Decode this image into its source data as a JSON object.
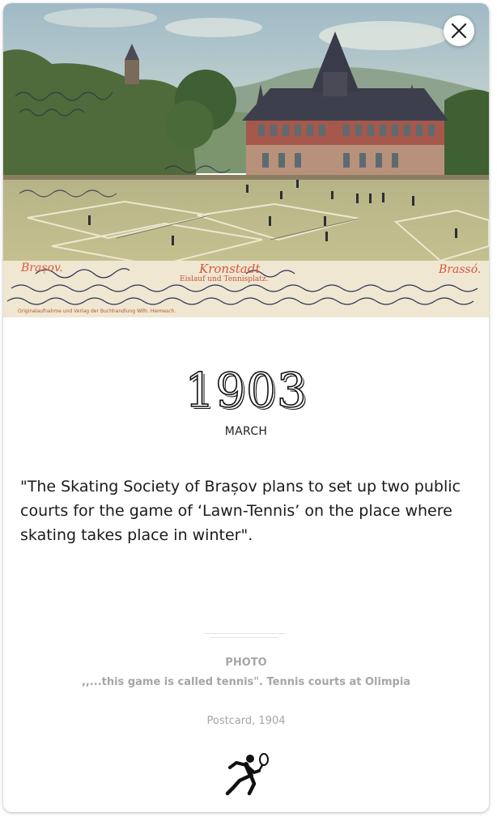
{
  "photo": {
    "postcard_inscriptions": {
      "left_place": "Brașov.",
      "center_place": "Kronstadt",
      "center_sub": "Eislauf und Tennisplatz.",
      "right_place": "Brassó.",
      "publisher": "Originalaufnahme und Verlag der Buchhandlung Wilh. Hiemesch."
    },
    "colors": {
      "sky": "#b9cdd2",
      "hill": "#7e9a86",
      "roof": "#3e3f4c",
      "building": "#a8564a",
      "court": "#c9c58f",
      "trees": "#4d6b3a",
      "inscription": "#d9573b",
      "postcard_border": "#efe6cf"
    }
  },
  "close": {
    "icon": "close-icon"
  },
  "event": {
    "year": "1903",
    "month": "MARCH",
    "quote": "\"The Skating Society of Brașov plans to set up two public courts for the game of ‘Lawn-Tennis’ on the place where skating takes place in winter\"."
  },
  "photo_info": {
    "label": "PHOTO",
    "caption": ",,...this game is called tennis\". Tennis courts at Olimpia",
    "source": "Postcard, 1904",
    "icon": "tennis-player-icon"
  }
}
